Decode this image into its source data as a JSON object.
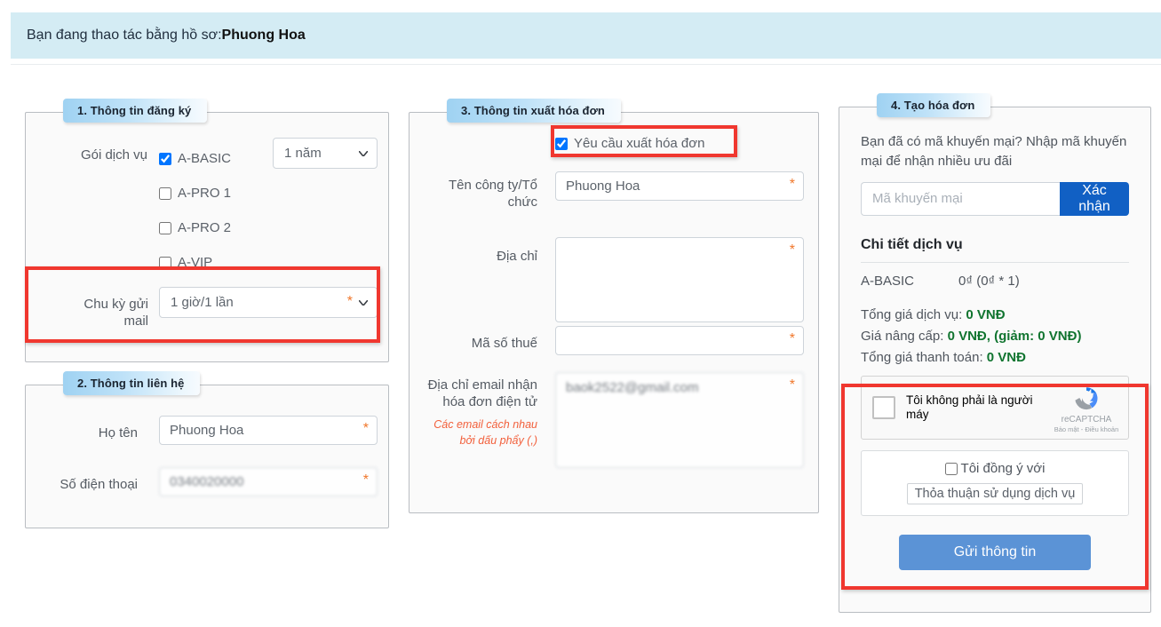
{
  "banner": {
    "prefix": "Bạn đang thao tác bằng hồ sơ: ",
    "profile_name": "Phuong Hoa"
  },
  "panel1": {
    "legend": "1. Thông tin đăng ký",
    "package_label": "Gói dịch vụ",
    "options": [
      {
        "label": "A-BASIC",
        "checked": true
      },
      {
        "label": "A-PRO 1",
        "checked": false
      },
      {
        "label": "A-PRO 2",
        "checked": false
      },
      {
        "label": "A-VIP",
        "checked": false
      }
    ],
    "term_select": {
      "value": "1 năm"
    },
    "cycle_label": "Chu kỳ gửi mail",
    "cycle_select": {
      "value": "1 giờ/1 lần"
    },
    "required_mark": "*"
  },
  "panel2": {
    "legend": "2. Thông tin liên hệ",
    "fields": [
      {
        "label": "Họ tên",
        "value": "Phuong Hoa",
        "blurred": false,
        "required_mark": "*"
      },
      {
        "label": "Số điện thoại",
        "value": "0340020000",
        "blurred": true,
        "required_mark": "*"
      }
    ]
  },
  "panel3": {
    "legend": "3. Thông tin xuất hóa đơn",
    "invoice_checkbox": {
      "label": "Yêu cầu xuất hóa đơn",
      "checked": true
    },
    "company_label": "Tên công ty/Tổ chức",
    "company_value": "Phuong Hoa",
    "address_label": "Địa chỉ",
    "address_value": "",
    "tax_label": "Mã số thuế",
    "tax_value": "",
    "email_label": "Địa chỉ email nhận hóa đơn điện tử",
    "email_hint": "Các email cách nhau bởi dấu phẩy (,)",
    "email_value": "baok2522@gmail.com",
    "required_mark": "*"
  },
  "panel4": {
    "legend": "4. Tạo hóa đơn",
    "promo_text": "Bạn đã có mã khuyến mại? Nhập mã khuyến mại để nhận nhiều ưu đãi",
    "promo_placeholder": "Mã khuyến mại",
    "promo_value": "",
    "promo_button": "Xác nhận",
    "detail_title": "Chi tiết dịch vụ",
    "detail_item": {
      "name": "A-BASIC",
      "price": "0₫ (0₫ * 1)"
    },
    "totals": [
      {
        "label": "Tổng giá dịch vụ: ",
        "value": "0 VNĐ"
      },
      {
        "label": "Giá nâng cấp: ",
        "value": "0 VNĐ, (giảm: 0 VNĐ)"
      },
      {
        "label": "Tổng giá thanh toán: ",
        "value": "0 VNĐ"
      }
    ],
    "recaptcha": {
      "label": "Tôi không phải là người máy",
      "brand": "reCAPTCHA",
      "legal": "Bảo mật - Điều khoản",
      "checked": false
    },
    "terms": {
      "label": "Tôi đồng ý với",
      "link": "Thỏa thuận sử dụng dịch vụ",
      "checked": false
    },
    "submit_button": "Gửi thông tin"
  },
  "colors": {
    "banner_bg": "#d4ecf4",
    "legend_blue": "#9fd2f2",
    "promo_button": "#1160c4",
    "submit_button": "#5b93d6",
    "required_orange": "#f0772b",
    "price_green": "#10742f",
    "hint_red": "#f2603c",
    "annotation_red": "#f0372f"
  }
}
